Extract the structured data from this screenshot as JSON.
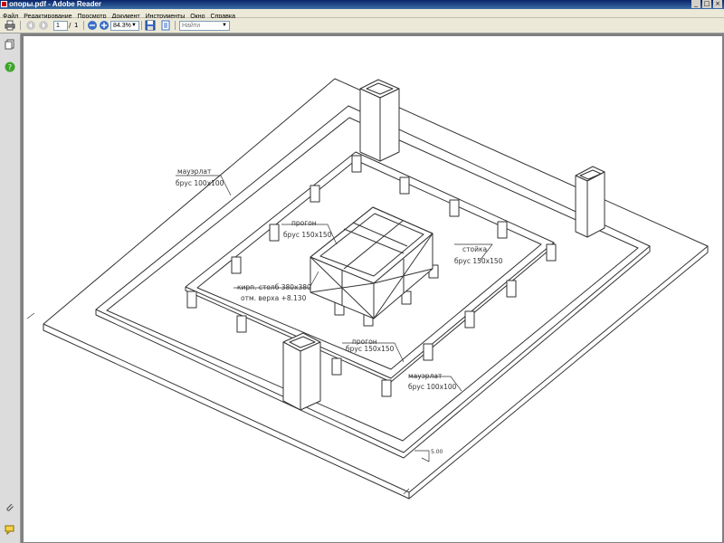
{
  "window": {
    "title": "опоры.pdf - Adobe Reader",
    "controls": [
      "_",
      "□",
      "×"
    ]
  },
  "menu": {
    "items": [
      "Файл",
      "Редактирование",
      "Просмотр",
      "Документ",
      "Инструменты",
      "Окно",
      "Справка"
    ]
  },
  "toolbar": {
    "page_current": "1",
    "page_separator": "/",
    "page_total": "1",
    "zoom": "84.3%",
    "search_placeholder": "Найти",
    "icons": [
      "print-icon",
      "prev-page-icon",
      "next-page-icon",
      "zoom-out-icon",
      "zoom-in-icon",
      "save-icon",
      "fit-page-icon"
    ]
  },
  "sidebar": {
    "icons": [
      "pages-icon",
      "help-icon",
      "attachments-icon",
      "comments-icon"
    ]
  },
  "drawing": {
    "labels": {
      "mauerlat_1_a": "мауэрлат",
      "mauerlat_1_b": "брус 100х100",
      "progon_1_a": "прогон",
      "progon_1_b": "брус 150х150",
      "stoyka_a": "стойка",
      "stoyka_b": "брус 150х150",
      "column_a": "кирп. столб 380х380",
      "column_b": "отм. верха +8.130",
      "progon_2_a": "прогон",
      "progon_2_b": "брус 150х150",
      "mauerlat_2_a": "мауэрлат",
      "mauerlat_2_b": "брус 100х100",
      "level_mark": "5.00"
    }
  }
}
